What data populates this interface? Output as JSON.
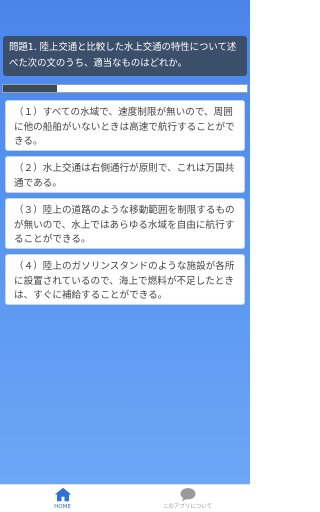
{
  "question": {
    "text": "問題1. 陸上交通と比較した水上交通の特性について述べた次の文のうち、適当なものはどれか。"
  },
  "progress": {
    "fraction": 0.22
  },
  "answers": [
    {
      "label": "（１）すべての水域で、速度制限が無いので、周囲に他の船舶がいないときは高速で航行することができる。"
    },
    {
      "label": "（２）水上交通は右側通行が原則で、これは万国共通である。"
    },
    {
      "label": "（３）陸上の道路のような移動範囲を制限するものが無いので、水上ではあらゆる水域を自由に航行することができる。"
    },
    {
      "label": "（４）陸上のガソリンスタンドのような施設が各所に設置されているので、海上で燃料が不足したときは、すぐに補給することができる。"
    }
  ],
  "tabs": {
    "home": {
      "label": "HOME",
      "icon": "home-icon",
      "color": "#2f72d6"
    },
    "about": {
      "label": "このアプリについて",
      "icon": "chat-bubble-icon",
      "color": "#9a9a9a"
    }
  },
  "colors": {
    "background_top": "#4a86ea",
    "background_bottom": "#6da6f6",
    "question_bg": "#3b4f6b",
    "progress_fill": "#3d4a5a"
  }
}
